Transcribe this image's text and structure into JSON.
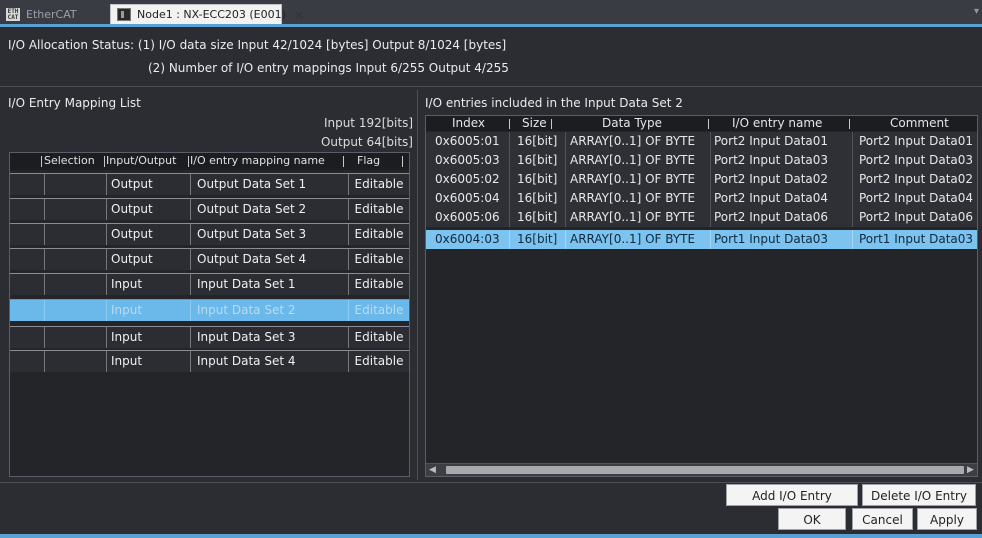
{
  "tabs": [
    {
      "label": "EtherCAT",
      "icon": "ethercat-icon",
      "active": false
    },
    {
      "label": "Node1 : NX-ECC203 (E001)",
      "icon": "node-device-icon",
      "active": true,
      "close": "×"
    }
  ],
  "status": {
    "line1": "I/O Allocation Status: (1) I/O data size Input 42/1024 [bytes] Output 8/1024 [bytes]",
    "line2": "(2) Number of I/O entry mappings Input 6/255 Output 4/255"
  },
  "left_panel": {
    "title": "I/O Entry Mapping List",
    "input_bits": "Input 192[bits]",
    "output_bits": "Output 64[bits]",
    "columns": [
      "Selection",
      "Input/Output",
      "I/O entry mapping name",
      "Flag"
    ],
    "rows": [
      {
        "io": "Output",
        "name": "Output Data Set 1",
        "flag": "Editable",
        "selected": false
      },
      {
        "io": "Output",
        "name": "Output Data Set 2",
        "flag": "Editable",
        "selected": false
      },
      {
        "io": "Output",
        "name": "Output Data Set 3",
        "flag": "Editable",
        "selected": false
      },
      {
        "io": "Output",
        "name": "Output Data Set 4",
        "flag": "Editable",
        "selected": false
      },
      {
        "io": "Input",
        "name": "Input Data Set 1",
        "flag": "Editable",
        "selected": false
      },
      {
        "io": "Input",
        "name": "Input Data Set 2",
        "flag": "Editable",
        "selected": true
      },
      {
        "io": "Input",
        "name": "Input Data Set 3",
        "flag": "Editable",
        "selected": false
      },
      {
        "io": "Input",
        "name": "Input Data Set 4",
        "flag": "Editable",
        "selected": false
      }
    ]
  },
  "right_panel": {
    "title": "I/O entries included in the Input Data Set 2",
    "columns": [
      "Index",
      "Size",
      "Data Type",
      "I/O entry name",
      "Comment"
    ],
    "rows": [
      {
        "index": "0x6005:01",
        "size": "16[bit]",
        "type": "ARRAY[0..1] OF BYTE",
        "name": "Port2 Input Data01",
        "comment": "Port2 Input Data01",
        "selected": false
      },
      {
        "index": "0x6005:03",
        "size": "16[bit]",
        "type": "ARRAY[0..1] OF BYTE",
        "name": "Port2 Input Data03",
        "comment": "Port2 Input Data03",
        "selected": false
      },
      {
        "index": "0x6005:02",
        "size": "16[bit]",
        "type": "ARRAY[0..1] OF BYTE",
        "name": "Port2 Input Data02",
        "comment": "Port2 Input Data02",
        "selected": false
      },
      {
        "index": "0x6005:04",
        "size": "16[bit]",
        "type": "ARRAY[0..1] OF BYTE",
        "name": "Port2 Input Data04",
        "comment": "Port2 Input Data04",
        "selected": false
      },
      {
        "index": "0x6005:06",
        "size": "16[bit]",
        "type": "ARRAY[0..1] OF BYTE",
        "name": "Port2 Input Data06",
        "comment": "Port2 Input Data06",
        "selected": false
      },
      {
        "index": "0x6004:03",
        "size": "16[bit]",
        "type": "ARRAY[0..1] OF BYTE",
        "name": "Port1 Input Data03",
        "comment": "Port1 Input Data03",
        "selected": true
      }
    ]
  },
  "buttons": {
    "add_entry": "Add I/O Entry",
    "delete_entry": "Delete I/O Entry",
    "ok": "OK",
    "cancel": "Cancel",
    "apply": "Apply"
  },
  "colors": {
    "accent": "#5aa2d6",
    "selection": "#6bb8ea",
    "background": "#2b2d33"
  }
}
